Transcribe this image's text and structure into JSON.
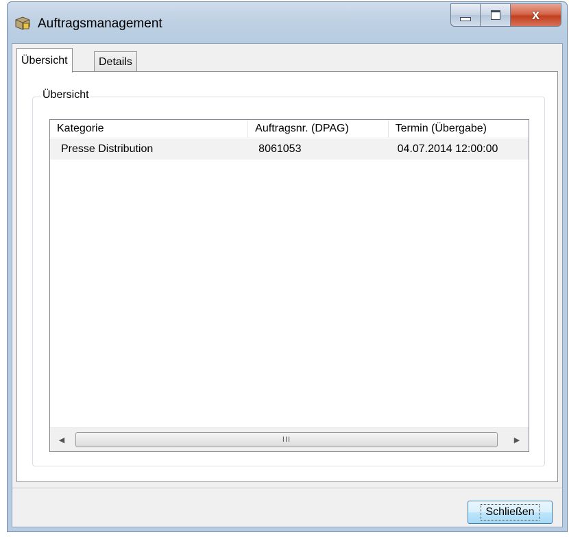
{
  "window": {
    "title": "Auftragsmanagement",
    "icon": "order-management-app-icon",
    "controls": {
      "minimize": "minimize-icon",
      "maximize": "maximize-icon",
      "close": "x"
    }
  },
  "tabs": [
    {
      "label": "Übersicht",
      "active": true
    },
    {
      "label": "Details",
      "active": false
    }
  ],
  "overview": {
    "group_label": "Übersicht",
    "columns": [
      "Kategorie",
      "Auftragsnr. (DPAG)",
      "Termin (Übergabe)"
    ],
    "rows": [
      [
        "Presse Distribution",
        "8061053",
        "04.07.2014 12:00:00"
      ]
    ],
    "scrollbar_grip": "III"
  },
  "footer": {
    "close_button": "Schließen"
  }
}
